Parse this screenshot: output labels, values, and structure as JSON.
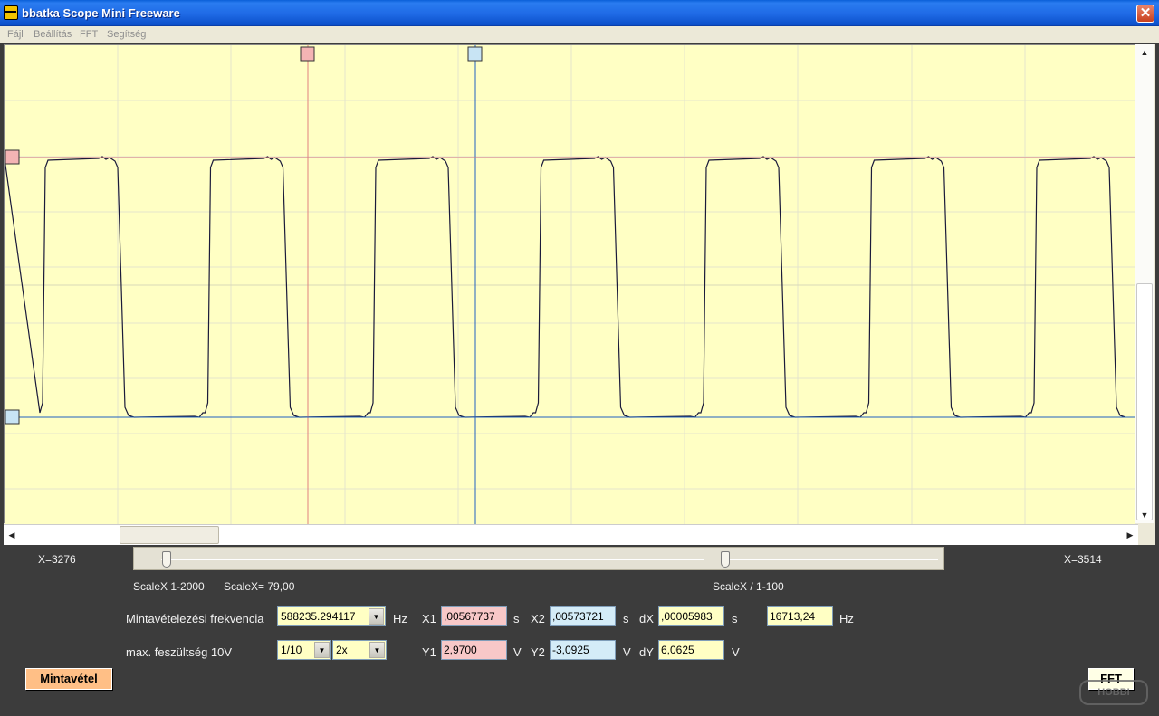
{
  "window": {
    "title": "bbatka Scope Mini Freeware",
    "close_label": "✕"
  },
  "menu": {
    "items": [
      "Fájl",
      "Beállítás",
      "FFT",
      "Segítség"
    ]
  },
  "plot": {
    "background": "#ffffc4",
    "grid_color": "#e4e4cc",
    "trace_color": "#1a1a3a",
    "cursor1_color": "#e08080",
    "cursor2_color": "#2060c0",
    "cursor1_marker_color": "#f4b4b4",
    "cursor2_marker_color": "#c8e4f4"
  },
  "slider": {
    "left_label": "X=3276",
    "right_label": "X=3514",
    "scale_range": "ScaleX 1-2000",
    "scale_value": "ScaleX= 79,00",
    "scale_div": "ScaleX / 1-100"
  },
  "controls": {
    "freq_label": "Mintavételezési frekvencia",
    "freq_value": "588235.294117",
    "freq_unit": "Hz",
    "maxv_label": "max. feszültség  10V",
    "maxv_divider": "1/10",
    "maxv_gain": "2x",
    "x1_label": "X1",
    "x1_value": ",00567737",
    "x1_unit": "s",
    "x2_label": "X2",
    "x2_value": ",00573721",
    "x2_unit": "s",
    "dx_label": "dX",
    "dx_value": ",00005983",
    "dx_unit": "s",
    "freq_result": "16713,24",
    "freq_result_unit": "Hz",
    "y1_label": "Y1",
    "y1_value": "2,9700",
    "y1_unit": "V",
    "y2_label": "Y2",
    "y2_value": "-3,0925",
    "y2_unit": "V",
    "dy_label": "dY",
    "dy_value": "6,0625",
    "dy_unit": "V",
    "x1_color": "#f8c8c8",
    "x2_color": "#d4ecf8",
    "result_color": "#ffffc4"
  },
  "buttons": {
    "sample": "Mintavétel",
    "fft": "FFT"
  },
  "watermark": {
    "text": "HOBBI"
  }
}
